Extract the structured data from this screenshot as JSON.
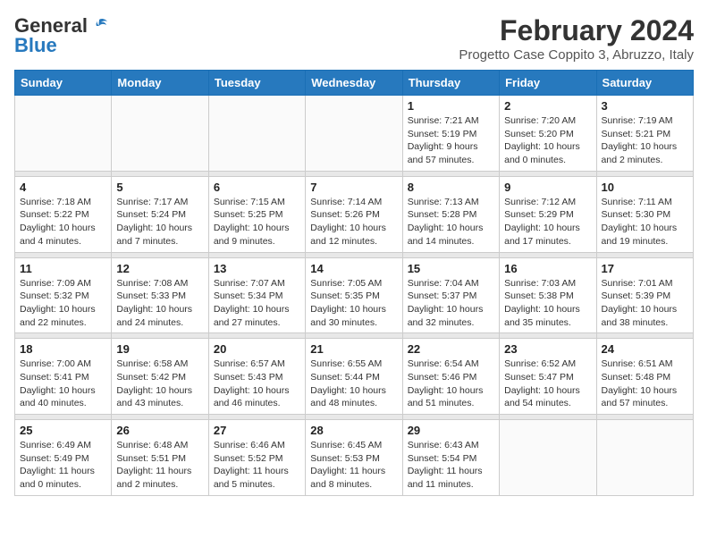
{
  "header": {
    "logo_general": "General",
    "logo_blue": "Blue",
    "month_title": "February 2024",
    "location": "Progetto Case Coppito 3, Abruzzo, Italy"
  },
  "days_of_week": [
    "Sunday",
    "Monday",
    "Tuesday",
    "Wednesday",
    "Thursday",
    "Friday",
    "Saturday"
  ],
  "weeks": [
    {
      "days": [
        {
          "num": "",
          "info": ""
        },
        {
          "num": "",
          "info": ""
        },
        {
          "num": "",
          "info": ""
        },
        {
          "num": "",
          "info": ""
        },
        {
          "num": "1",
          "info": "Sunrise: 7:21 AM\nSunset: 5:19 PM\nDaylight: 9 hours\nand 57 minutes."
        },
        {
          "num": "2",
          "info": "Sunrise: 7:20 AM\nSunset: 5:20 PM\nDaylight: 10 hours\nand 0 minutes."
        },
        {
          "num": "3",
          "info": "Sunrise: 7:19 AM\nSunset: 5:21 PM\nDaylight: 10 hours\nand 2 minutes."
        }
      ]
    },
    {
      "days": [
        {
          "num": "4",
          "info": "Sunrise: 7:18 AM\nSunset: 5:22 PM\nDaylight: 10 hours\nand 4 minutes."
        },
        {
          "num": "5",
          "info": "Sunrise: 7:17 AM\nSunset: 5:24 PM\nDaylight: 10 hours\nand 7 minutes."
        },
        {
          "num": "6",
          "info": "Sunrise: 7:15 AM\nSunset: 5:25 PM\nDaylight: 10 hours\nand 9 minutes."
        },
        {
          "num": "7",
          "info": "Sunrise: 7:14 AM\nSunset: 5:26 PM\nDaylight: 10 hours\nand 12 minutes."
        },
        {
          "num": "8",
          "info": "Sunrise: 7:13 AM\nSunset: 5:28 PM\nDaylight: 10 hours\nand 14 minutes."
        },
        {
          "num": "9",
          "info": "Sunrise: 7:12 AM\nSunset: 5:29 PM\nDaylight: 10 hours\nand 17 minutes."
        },
        {
          "num": "10",
          "info": "Sunrise: 7:11 AM\nSunset: 5:30 PM\nDaylight: 10 hours\nand 19 minutes."
        }
      ]
    },
    {
      "days": [
        {
          "num": "11",
          "info": "Sunrise: 7:09 AM\nSunset: 5:32 PM\nDaylight: 10 hours\nand 22 minutes."
        },
        {
          "num": "12",
          "info": "Sunrise: 7:08 AM\nSunset: 5:33 PM\nDaylight: 10 hours\nand 24 minutes."
        },
        {
          "num": "13",
          "info": "Sunrise: 7:07 AM\nSunset: 5:34 PM\nDaylight: 10 hours\nand 27 minutes."
        },
        {
          "num": "14",
          "info": "Sunrise: 7:05 AM\nSunset: 5:35 PM\nDaylight: 10 hours\nand 30 minutes."
        },
        {
          "num": "15",
          "info": "Sunrise: 7:04 AM\nSunset: 5:37 PM\nDaylight: 10 hours\nand 32 minutes."
        },
        {
          "num": "16",
          "info": "Sunrise: 7:03 AM\nSunset: 5:38 PM\nDaylight: 10 hours\nand 35 minutes."
        },
        {
          "num": "17",
          "info": "Sunrise: 7:01 AM\nSunset: 5:39 PM\nDaylight: 10 hours\nand 38 minutes."
        }
      ]
    },
    {
      "days": [
        {
          "num": "18",
          "info": "Sunrise: 7:00 AM\nSunset: 5:41 PM\nDaylight: 10 hours\nand 40 minutes."
        },
        {
          "num": "19",
          "info": "Sunrise: 6:58 AM\nSunset: 5:42 PM\nDaylight: 10 hours\nand 43 minutes."
        },
        {
          "num": "20",
          "info": "Sunrise: 6:57 AM\nSunset: 5:43 PM\nDaylight: 10 hours\nand 46 minutes."
        },
        {
          "num": "21",
          "info": "Sunrise: 6:55 AM\nSunset: 5:44 PM\nDaylight: 10 hours\nand 48 minutes."
        },
        {
          "num": "22",
          "info": "Sunrise: 6:54 AM\nSunset: 5:46 PM\nDaylight: 10 hours\nand 51 minutes."
        },
        {
          "num": "23",
          "info": "Sunrise: 6:52 AM\nSunset: 5:47 PM\nDaylight: 10 hours\nand 54 minutes."
        },
        {
          "num": "24",
          "info": "Sunrise: 6:51 AM\nSunset: 5:48 PM\nDaylight: 10 hours\nand 57 minutes."
        }
      ]
    },
    {
      "days": [
        {
          "num": "25",
          "info": "Sunrise: 6:49 AM\nSunset: 5:49 PM\nDaylight: 11 hours\nand 0 minutes."
        },
        {
          "num": "26",
          "info": "Sunrise: 6:48 AM\nSunset: 5:51 PM\nDaylight: 11 hours\nand 2 minutes."
        },
        {
          "num": "27",
          "info": "Sunrise: 6:46 AM\nSunset: 5:52 PM\nDaylight: 11 hours\nand 5 minutes."
        },
        {
          "num": "28",
          "info": "Sunrise: 6:45 AM\nSunset: 5:53 PM\nDaylight: 11 hours\nand 8 minutes."
        },
        {
          "num": "29",
          "info": "Sunrise: 6:43 AM\nSunset: 5:54 PM\nDaylight: 11 hours\nand 11 minutes."
        },
        {
          "num": "",
          "info": ""
        },
        {
          "num": "",
          "info": ""
        }
      ]
    }
  ]
}
